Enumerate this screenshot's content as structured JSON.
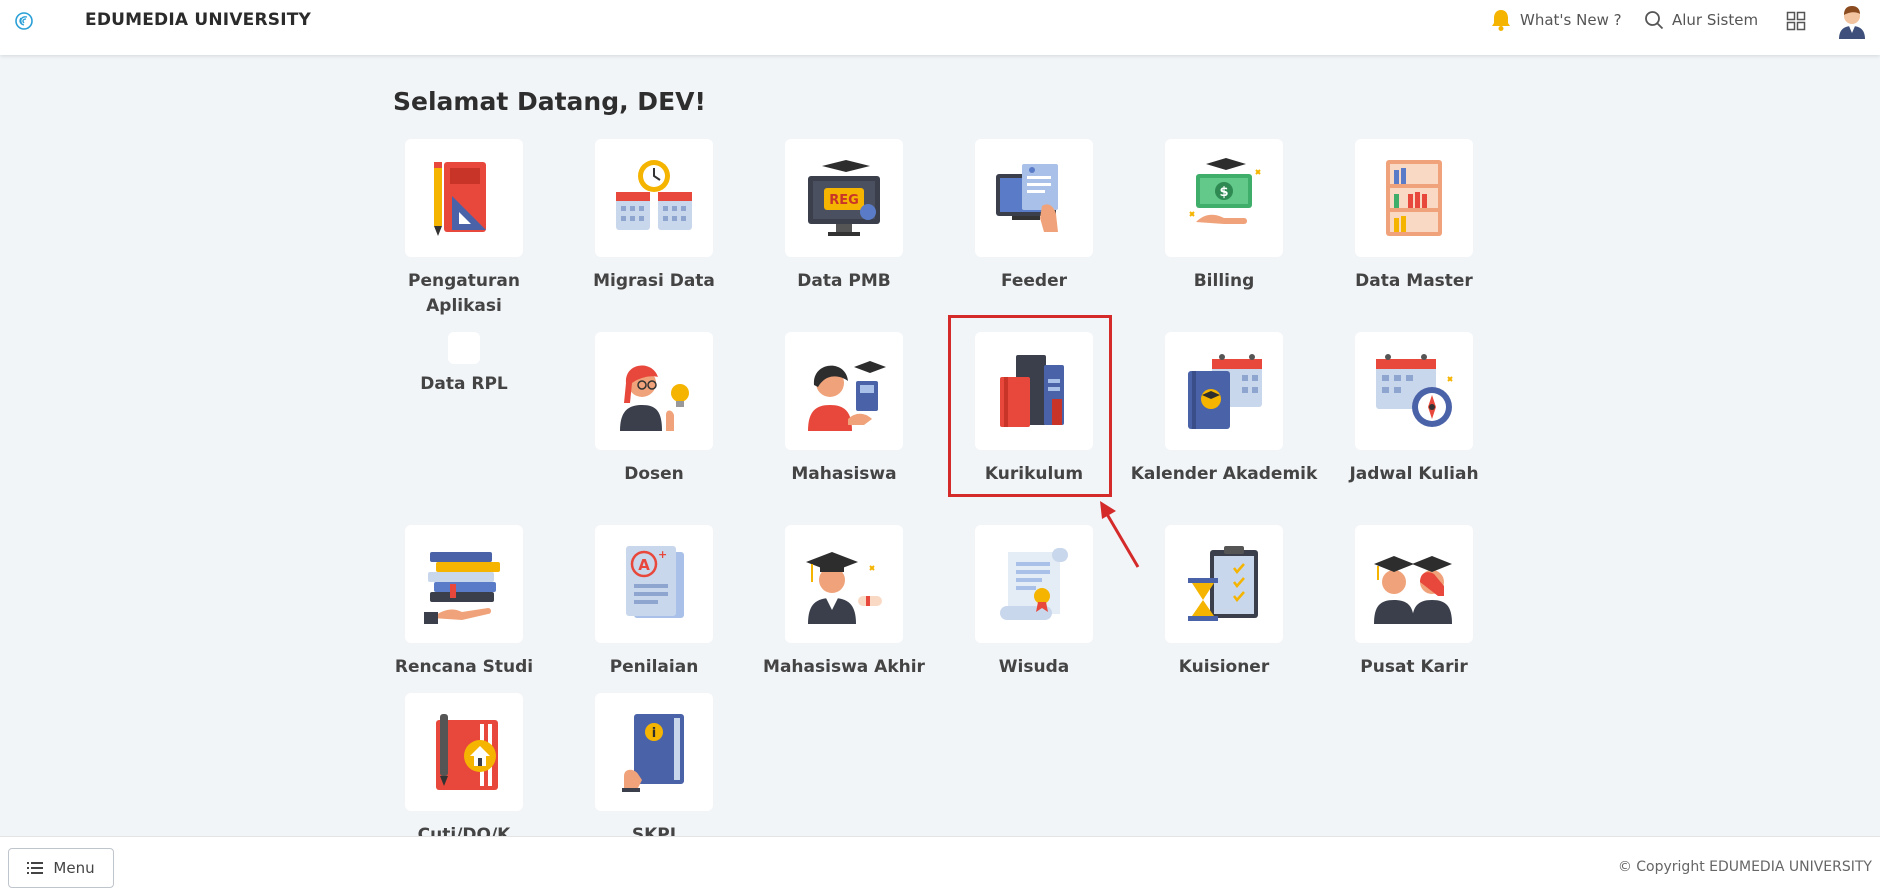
{
  "header": {
    "brand": "EDUMEDIA UNIVERSITY",
    "whats_new": "What's New ?",
    "alur_sistem": "Alur Sistem"
  },
  "main": {
    "welcome": "Selamat Datang, DEV!",
    "tiles": [
      {
        "label": "Pengaturan Aplikasi",
        "icon": "settings-ruler-book-icon"
      },
      {
        "label": "Migrasi Data",
        "icon": "calendar-clock-icon"
      },
      {
        "label": "Data PMB",
        "icon": "registration-monitor-icon"
      },
      {
        "label": "Feeder",
        "icon": "document-hand-icon"
      },
      {
        "label": "Billing",
        "icon": "money-bill-icon"
      },
      {
        "label": "Data Master",
        "icon": "bookshelf-icon"
      },
      {
        "label": "Data RPL",
        "icon": "blank-icon"
      },
      {
        "label": "Dosen",
        "icon": "lecturer-icon"
      },
      {
        "label": "Mahasiswa",
        "icon": "student-icon"
      },
      {
        "label": "Kurikulum",
        "icon": "books-icon"
      },
      {
        "label": "Kalender Akademik",
        "icon": "academic-calendar-icon"
      },
      {
        "label": "Jadwal Kuliah",
        "icon": "schedule-compass-icon"
      },
      {
        "label": "Rencana Studi",
        "icon": "book-stack-hand-icon"
      },
      {
        "label": "Penilaian",
        "icon": "grade-paper-icon"
      },
      {
        "label": "Mahasiswa Akhir",
        "icon": "graduate-diploma-icon"
      },
      {
        "label": "Wisuda",
        "icon": "certificate-scroll-icon"
      },
      {
        "label": "Kuisioner",
        "icon": "clipboard-hourglass-icon"
      },
      {
        "label": "Pusat Karir",
        "icon": "graduates-icon"
      },
      {
        "label": "Cuti/DO/K",
        "icon": "notebook-home-icon"
      },
      {
        "label": "SKPI",
        "icon": "info-book-icon"
      }
    ]
  },
  "footer": {
    "menu_label": "Menu",
    "copyright": "© Copyright EDUMEDIA UNIVERSITY"
  },
  "colors": {
    "background": "#f2f5f8",
    "highlight": "#d42a2a",
    "brand_text": "#2b2b2b"
  }
}
